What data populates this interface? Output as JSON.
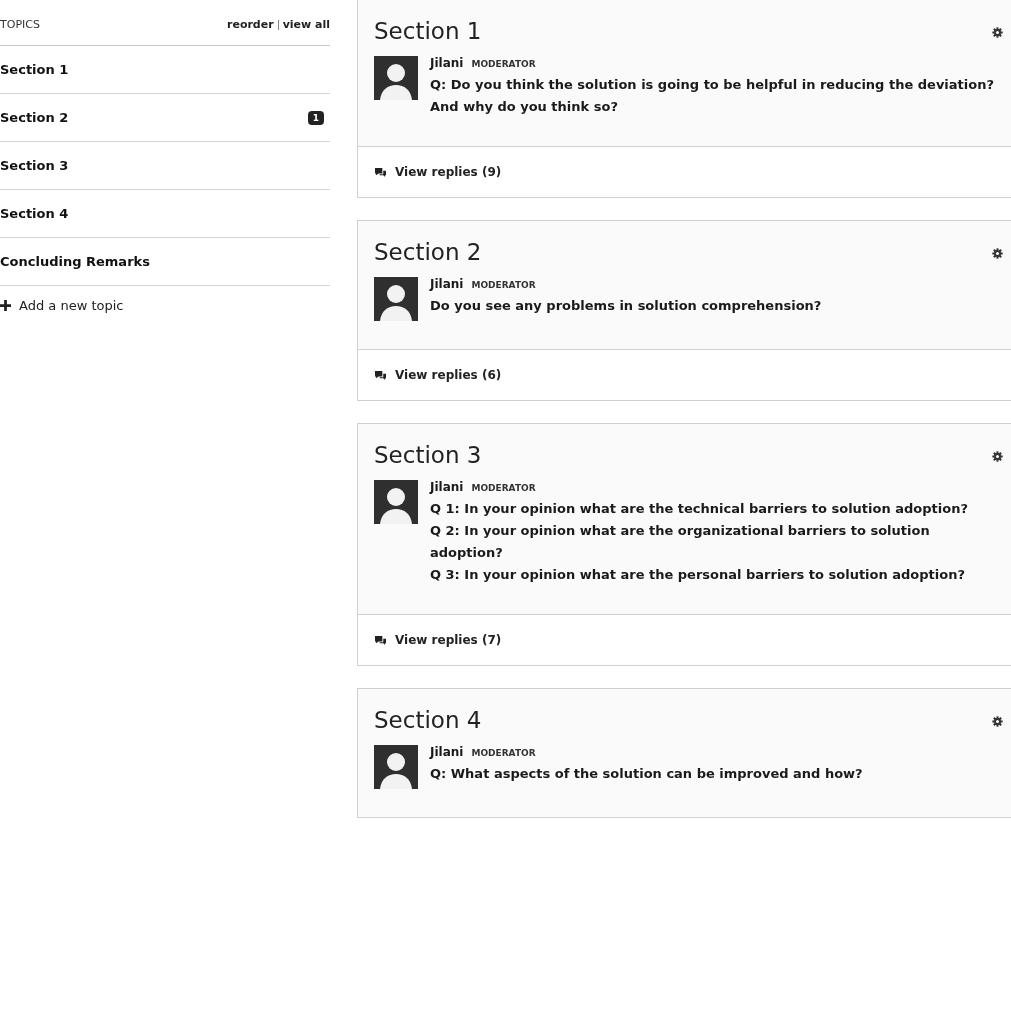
{
  "sidebar": {
    "heading": "TOPICS",
    "links": [
      "reorder",
      "view all"
    ],
    "topics": [
      {
        "label": "Section 1"
      },
      {
        "label": "Section 2",
        "badge": "1"
      },
      {
        "label": "Section 3"
      },
      {
        "label": "Section 4"
      },
      {
        "label": "Concluding Remarks"
      }
    ],
    "add_topic": "Add a new topic"
  },
  "sections": [
    {
      "title": "Section 1",
      "author": "Jilani",
      "role": "MODERATOR",
      "questions": [
        "Q: Do you think the solution is going to be helpful in reducing the deviation? And why do you think so?"
      ],
      "replies": "View replies (9)"
    },
    {
      "title": "Section 2",
      "author": "Jilani",
      "role": "MODERATOR",
      "questions": [
        "Do you see any problems in solution comprehension?"
      ],
      "replies": "View replies (6)"
    },
    {
      "title": "Section 3",
      "author": "Jilani",
      "role": "MODERATOR",
      "questions": [
        "Q 1: In your opinion what are the technical barriers to solution adoption?",
        "Q 2: In your opinion what are the organizational barriers to solution adoption?",
        "Q 3: In your opinion what are the personal barriers to solution adoption?"
      ],
      "replies": "View replies (7)"
    },
    {
      "title": "Section 4",
      "author": "Jilani",
      "role": "MODERATOR",
      "questions": [
        "Q: What aspects of the solution can be improved and how?"
      ]
    }
  ]
}
